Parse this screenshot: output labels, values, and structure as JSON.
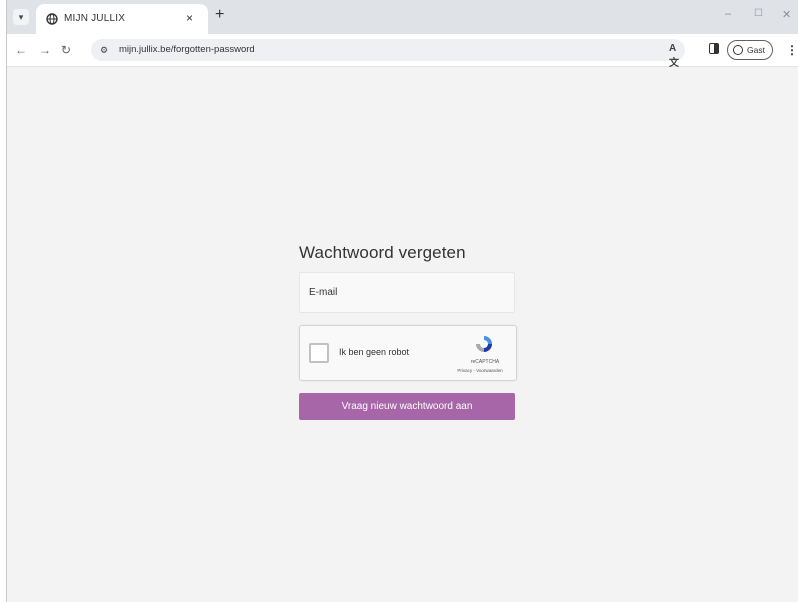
{
  "browser": {
    "tab": {
      "title": "MIJN JULLIX",
      "close_glyph": "×"
    },
    "new_tab_glyph": "+",
    "address_bar": {
      "url": "mijn.jullix.be/forgotten-password"
    },
    "profile": {
      "label": "Gast"
    },
    "icons": {
      "tab_search": "tab-search-icon",
      "favicon": "globe-icon",
      "back": "back-arrow-icon",
      "forward": "forward-arrow-icon",
      "reload": "reload-icon",
      "site_info": "tune-icon",
      "translate": "translate-icon",
      "side_panel": "side-panel-icon",
      "menu": "kebab-menu-icon"
    }
  },
  "page": {
    "title": "Wachtwoord vergeten",
    "email_placeholder": "E-mail",
    "recaptcha": {
      "label": "Ik ben geen robot",
      "brand": "reCAPTCHA",
      "links": "Privacy - Voorwaarden"
    },
    "submit_label": "Vraag nieuw wachtwoord aan"
  },
  "colors": {
    "accent": "#a766a8",
    "page_background": "#f3f3f3",
    "tab_strip": "#dfe3e8"
  }
}
